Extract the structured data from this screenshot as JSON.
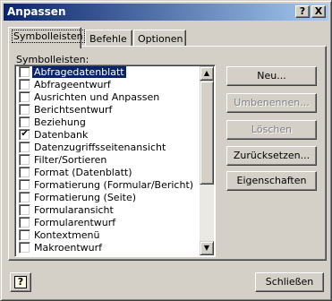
{
  "window": {
    "title": "Anpassen",
    "help_button": "?",
    "close_button": "X"
  },
  "tabs": [
    {
      "label": "Symbolleisten",
      "active": true
    },
    {
      "label": "Befehle",
      "active": false
    },
    {
      "label": "Optionen",
      "active": false
    }
  ],
  "list": {
    "label": "Symbolleisten:",
    "items": [
      {
        "label": "Abfragedatenblatt",
        "checked": false,
        "selected": true
      },
      {
        "label": "Abfrageentwurf",
        "checked": false,
        "selected": false
      },
      {
        "label": "Ausrichten und Anpassen",
        "checked": false,
        "selected": false
      },
      {
        "label": "Berichtsentwurf",
        "checked": false,
        "selected": false
      },
      {
        "label": "Beziehung",
        "checked": false,
        "selected": false
      },
      {
        "label": "Datenbank",
        "checked": true,
        "selected": false
      },
      {
        "label": "Datenzugriffsseitenansicht",
        "checked": false,
        "selected": false
      },
      {
        "label": "Filter/Sortieren",
        "checked": false,
        "selected": false
      },
      {
        "label": "Format (Datenblatt)",
        "checked": false,
        "selected": false
      },
      {
        "label": "Formatierung (Formular/Bericht)",
        "checked": false,
        "selected": false
      },
      {
        "label": "Formatierung (Seite)",
        "checked": false,
        "selected": false
      },
      {
        "label": "Formularansicht",
        "checked": false,
        "selected": false
      },
      {
        "label": "Formularentwurf",
        "checked": false,
        "selected": false
      },
      {
        "label": "Kontextmenü",
        "checked": false,
        "selected": false
      },
      {
        "label": "Makroentwurf",
        "checked": false,
        "selected": false
      }
    ]
  },
  "buttons": {
    "new": "Neu...",
    "rename": "Umbenennen...",
    "delete": "Löschen",
    "reset": "Zurücksetzen...",
    "properties": "Eigenschaften",
    "close": "Schließen"
  },
  "footer": {
    "help_icon": "?"
  }
}
